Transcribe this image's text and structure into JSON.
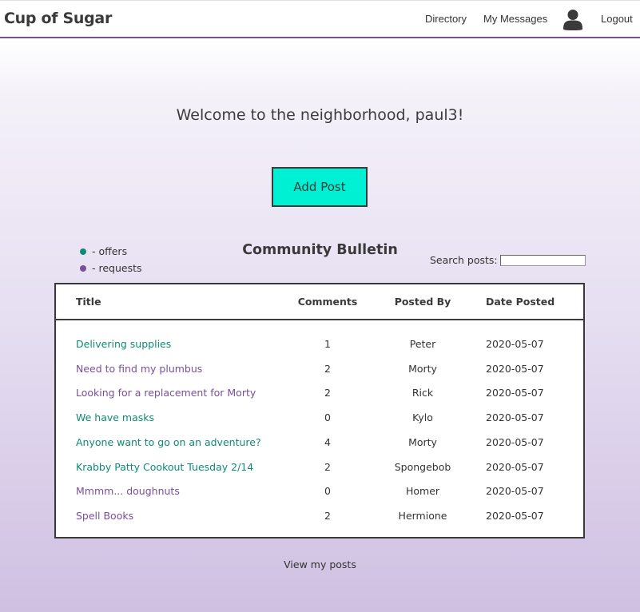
{
  "header": {
    "brand": "Cup of Sugar",
    "nav": {
      "directory": "Directory",
      "messages": "My Messages",
      "logout": "Logout"
    },
    "user_icon": "user-icon"
  },
  "welcome_text": "Welcome to the neighborhood, paul3!",
  "add_post_label": "Add Post",
  "legend": {
    "offers_label": "- offers",
    "requests_label": "- requests"
  },
  "colors": {
    "offer": "#0f8a74",
    "request": "#7a4f9a",
    "add_post_bg": "#00f0d4",
    "nav_border": "#7a4f9a"
  },
  "bulletin_title": "Community Bulletin",
  "search": {
    "label": "Search posts:",
    "value": "",
    "placeholder": ""
  },
  "table": {
    "headers": {
      "title": "Title",
      "comments": "Comments",
      "posted_by": "Posted By",
      "date_posted": "Date Posted"
    },
    "rows": [
      {
        "title": "Delivering supplies",
        "comments": "1",
        "posted_by": "Peter",
        "date": "2020-05-07",
        "kind": "offer"
      },
      {
        "title": "Need to find my plumbus",
        "comments": "2",
        "posted_by": "Morty",
        "date": "2020-05-07",
        "kind": "request"
      },
      {
        "title": "Looking for a replacement for Morty",
        "comments": "2",
        "posted_by": "Rick",
        "date": "2020-05-07",
        "kind": "request"
      },
      {
        "title": "We have masks",
        "comments": "0",
        "posted_by": "Kylo",
        "date": "2020-05-07",
        "kind": "offer"
      },
      {
        "title": "Anyone want to go on an adventure?",
        "comments": "4",
        "posted_by": "Morty",
        "date": "2020-05-07",
        "kind": "offer"
      },
      {
        "title": "Krabby Patty Cookout Tuesday 2/14",
        "comments": "2",
        "posted_by": "Spongebob",
        "date": "2020-05-07",
        "kind": "offer"
      },
      {
        "title": "Mmmm... doughnuts",
        "comments": "0",
        "posted_by": "Homer",
        "date": "2020-05-07",
        "kind": "request"
      },
      {
        "title": "Spell Books",
        "comments": "2",
        "posted_by": "Hermione",
        "date": "2020-05-07",
        "kind": "request"
      }
    ]
  },
  "view_my_posts_label": "View my posts"
}
